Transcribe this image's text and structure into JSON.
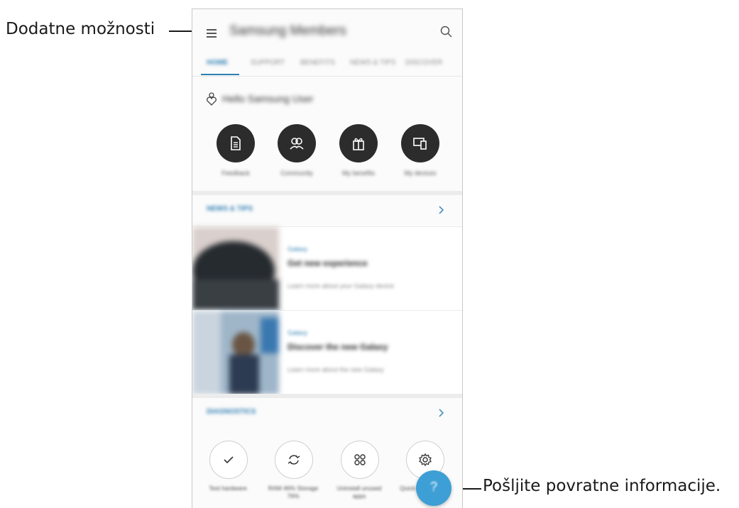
{
  "callouts": {
    "more_options": "Dodatne možnosti",
    "send_feedback": "Pošljite povratne informacije."
  },
  "app": {
    "title": "Samsung Members",
    "tabs": [
      {
        "label": "HOME",
        "active": true
      },
      {
        "label": "SUPPORT",
        "active": false
      },
      {
        "label": "BENEFITS",
        "active": false
      },
      {
        "label": "NEWS & TIPS",
        "active": false
      },
      {
        "label": "DISCOVER",
        "active": false
      }
    ],
    "greeting": "Hello Samsung User",
    "quick_actions": [
      {
        "label": "Feedback",
        "icon": "document-icon"
      },
      {
        "label": "Community",
        "icon": "people-icon"
      },
      {
        "label": "My benefits",
        "icon": "gift-icon"
      },
      {
        "label": "My devices",
        "icon": "devices-icon"
      }
    ],
    "news_section": {
      "label": "NEWS & TIPS",
      "articles": [
        {
          "category": "Galaxy",
          "title": "Get new experience",
          "desc": "Learn more about your Galaxy device"
        },
        {
          "category": "Galaxy",
          "title": "Discover the new Galaxy",
          "desc": "Learn more about the new Galaxy"
        }
      ]
    },
    "diagnostics_section": {
      "label": "DIAGNOSTICS",
      "items": [
        {
          "label": "Test hardware",
          "icon": "check-icon"
        },
        {
          "label": "RAM 46% Storage 76%",
          "icon": "refresh-icon"
        },
        {
          "label": "Uninstall unused apps",
          "icon": "apps-grid-icon"
        },
        {
          "label": "Quick optimization",
          "icon": "settings-gear-icon"
        }
      ]
    },
    "fab_label": "?"
  },
  "colors": {
    "accent": "#2f7fb4",
    "fab": "#3d9fd5",
    "dark_button": "#2c2c2c"
  }
}
